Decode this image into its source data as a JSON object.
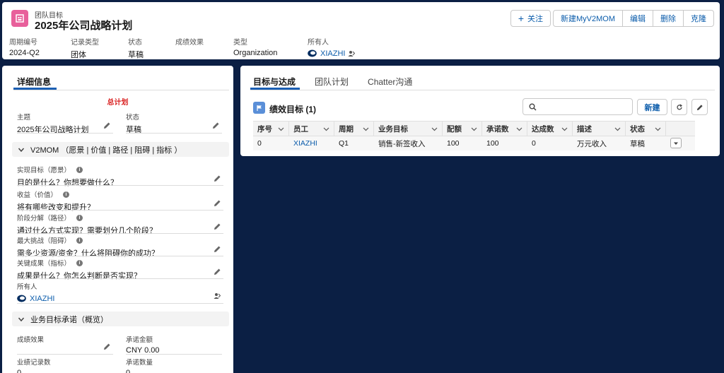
{
  "header": {
    "object_type": "团队目标",
    "title": "2025年公司战略计划",
    "actions": {
      "follow": "关注",
      "new_v2mom": "新建MyV2MOM",
      "edit": "编辑",
      "delete": "删除",
      "clone": "克隆"
    },
    "highlights": [
      {
        "label": "周期编号",
        "value": "2024-Q2"
      },
      {
        "label": "记录类型",
        "value": "团体"
      },
      {
        "label": "状态",
        "value": "草稿"
      },
      {
        "label": "成绩效果",
        "value": ""
      },
      {
        "label": "类型",
        "value": "Organization"
      },
      {
        "label": "所有人",
        "value": "XIAZHI"
      }
    ]
  },
  "left": {
    "tab": "详细信息",
    "master_plan": "总计划",
    "subject": {
      "label": "主题",
      "value": "2025年公司战略计划"
    },
    "status": {
      "label": "状态",
      "value": "草稿"
    },
    "section_v2mom": "V2MOM （愿景 | 价值 | 路径 | 阻碍 | 指标 ）",
    "v2mom_fields": [
      {
        "label": "实现目标（愿景）",
        "value": "目的是什么？你想要做什么？"
      },
      {
        "label": "收益（价值）",
        "value": "将有哪些改变和提升？"
      },
      {
        "label": "阶段分解（路径）",
        "value": "通过什么方式实现？需要划分几个阶段？"
      },
      {
        "label": "最大挑战（阻碍）",
        "value": "需多少资源/资金？什么将阻碍你的成功？"
      },
      {
        "label": "关键成果（指标）",
        "value": "成果是什么？你怎么判断是否实现？"
      }
    ],
    "owner": {
      "label": "所有人",
      "value": "XIAZHI"
    },
    "section_commit": "业务目标承诺（概览）",
    "commit_fields": [
      {
        "label": "成绩效果",
        "value": ""
      },
      {
        "label": "承诺金额",
        "value": "CNY 0.00"
      },
      {
        "label": "业绩记录数",
        "value": "0"
      },
      {
        "label": "承诺数量",
        "value": "0"
      }
    ]
  },
  "right": {
    "tabs": [
      "目标与达成",
      "团队计划",
      "Chatter沟通"
    ],
    "list_title": "绩效目标 (1)",
    "search_placeholder": "",
    "new_label": "新建",
    "columns": [
      "序号",
      "员工",
      "周期",
      "业务目标",
      "配额",
      "承诺数",
      "达成数",
      "描述",
      "状态"
    ],
    "rows": [
      [
        "0",
        "XIAZHI",
        "Q1",
        "销售-新签收入",
        "100",
        "100",
        "0",
        "万元收入",
        "草稿"
      ]
    ]
  },
  "colors": {
    "background": "#0b1f44",
    "accent": "#1b5fb3",
    "link": "#0b5cab",
    "object_icon": "#e8609b",
    "alert": "#d92020"
  }
}
